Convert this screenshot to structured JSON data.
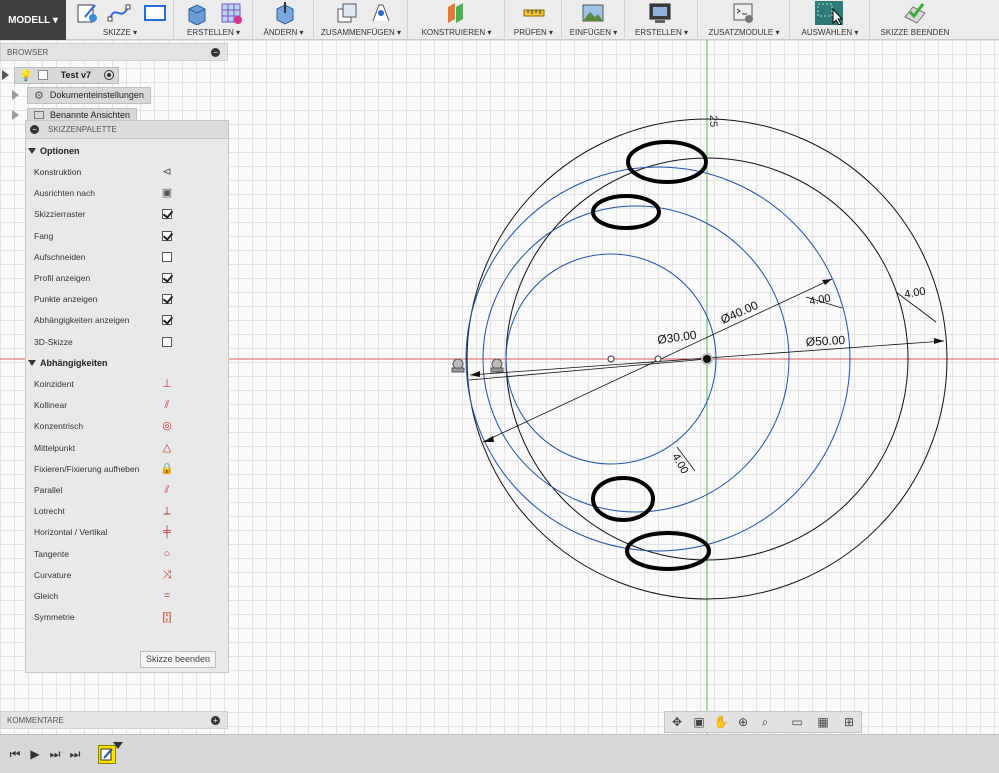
{
  "toolbar": {
    "mode": "MODELL ▾",
    "groups": [
      {
        "id": "skizze",
        "label": "SKIZZE ▾"
      },
      {
        "id": "erstellen",
        "label": "ERSTELLEN ▾"
      },
      {
        "id": "aendern",
        "label": "ÄNDERN ▾"
      },
      {
        "id": "zusammenfuegen",
        "label": "ZUSAMMENFÜGEN ▾"
      },
      {
        "id": "konstruieren",
        "label": "KONSTRUIEREN ▾"
      },
      {
        "id": "pruefen",
        "label": "PRÜFEN ▾"
      },
      {
        "id": "einfuegen",
        "label": "EINFÜGEN ▾"
      },
      {
        "id": "erstellen2",
        "label": "ERSTELLEN ▾"
      },
      {
        "id": "zusatzmodule",
        "label": "ZUSATZMODULE ▾"
      },
      {
        "id": "auswaehlen",
        "label": "AUSWÄHLEN ▾"
      },
      {
        "id": "skizze-beenden",
        "label": "SKIZZE BEENDEN"
      }
    ]
  },
  "browser": {
    "title": "BROWSER",
    "root": "Test v7",
    "items": [
      "Dokumenteinstellungen",
      "Benannte Ansichten"
    ]
  },
  "palette": {
    "title": "SKIZZENPALETTE",
    "options_title": "Optionen",
    "options": [
      {
        "label": "Konstruktion",
        "control": "icon",
        "icon": "construction-angle-icon",
        "glyph": "⊲"
      },
      {
        "label": "Ausrichten nach",
        "control": "icon",
        "icon": "look-at-icon",
        "glyph": "▣"
      },
      {
        "label": "Skizzierraster",
        "control": "checkbox",
        "checked": true
      },
      {
        "label": "Fang",
        "control": "checkbox",
        "checked": true
      },
      {
        "label": "Aufschneiden",
        "control": "checkbox",
        "checked": false
      },
      {
        "label": "Profil anzeigen",
        "control": "checkbox",
        "checked": true
      },
      {
        "label": "Punkte anzeigen",
        "control": "checkbox",
        "checked": true
      },
      {
        "label": "Abhängigkeiten anzeigen",
        "control": "checkbox",
        "checked": true
      },
      {
        "label": "3D-Skizze",
        "control": "checkbox",
        "checked": false
      }
    ],
    "constraints_title": "Abhängigkeiten",
    "constraints": [
      {
        "label": "Koinzident",
        "icon": "coincident-icon",
        "glyph": "⊥"
      },
      {
        "label": "Kollinear",
        "icon": "collinear-icon",
        "glyph": "⫽"
      },
      {
        "label": "Konzentrisch",
        "icon": "concentric-icon",
        "glyph": "◎"
      },
      {
        "label": "Mittelpunkt",
        "icon": "midpoint-icon",
        "glyph": "△"
      },
      {
        "label": "Fixieren/Fixierung aufheben",
        "icon": "fix-lock-icon",
        "glyph": "🔒"
      },
      {
        "label": "Parallel",
        "icon": "parallel-icon",
        "glyph": "⫽"
      },
      {
        "label": "Lotrecht",
        "icon": "perpendicular-icon",
        "glyph": "⟂"
      },
      {
        "label": "Horizontal / Vertikal",
        "icon": "horizontal-vertical-icon",
        "glyph": "╪"
      },
      {
        "label": "Tangente",
        "icon": "tangent-icon",
        "glyph": "○"
      },
      {
        "label": "Curvature",
        "icon": "curvature-icon",
        "glyph": "⤨"
      },
      {
        "label": "Gleich",
        "icon": "equal-icon",
        "glyph": "="
      },
      {
        "label": "Symmetrie",
        "icon": "symmetry-icon",
        "glyph": "[¦]"
      }
    ],
    "finish_button": "Skizze beenden"
  },
  "comments": {
    "title": "KOMMENTARE"
  },
  "sketch": {
    "dimensions": {
      "top_vertical": "25",
      "d30": "Ø30.00",
      "d40": "Ø40.00",
      "d50": "Ø50.00",
      "offset_inner": "4.00",
      "offset_mid": "4.00",
      "offset_outer": "4.00"
    },
    "colors": {
      "profile_blue": "#1f4fa8",
      "black": "#111111",
      "axis_red": "#e05555",
      "axis_green": "#55bb55"
    }
  },
  "navbar": {
    "icons": [
      "orbit-icon",
      "look-at-icon",
      "pan-icon",
      "zoom-icon",
      "zoom-window-icon",
      "display-settings-icon",
      "grid-settings-icon",
      "viewports-icon"
    ]
  },
  "timeline": {
    "controls": [
      "go-to-start-icon",
      "play-icon",
      "step-forward-icon",
      "go-to-end-icon"
    ]
  }
}
